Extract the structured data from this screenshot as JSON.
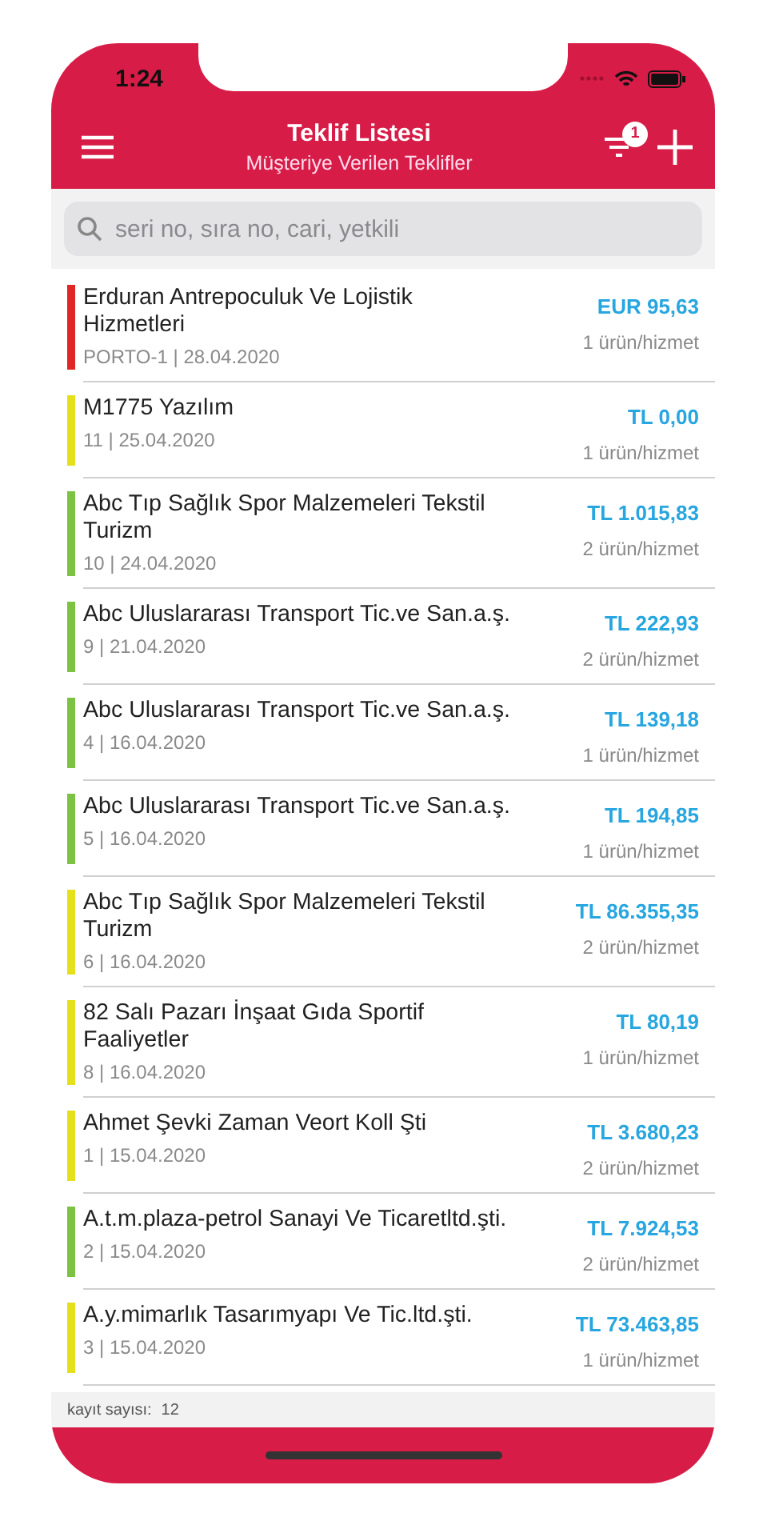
{
  "status_bar": {
    "time": "1:24"
  },
  "header": {
    "title": "Teklif Listesi",
    "subtitle": "Müşteriye Verilen Teklifler",
    "filter_badge": "1"
  },
  "search": {
    "placeholder": "seri no, sıra no, cari, yetkili"
  },
  "offers": [
    {
      "name": "Erduran Antrepoculuk Ve Lojistik Hizmetleri",
      "meta": "PORTO-1 | 28.04.2020",
      "amount": "EUR 95,63",
      "items": "1 ürün/hizmet",
      "color": "#e02626"
    },
    {
      "name": "M1775 Yazılım",
      "meta": "11 | 25.04.2020",
      "amount": "TL 0,00",
      "items": "1 ürün/hizmet",
      "color": "#e4e01c"
    },
    {
      "name": "Abc Tıp Sağlık Spor Malzemeleri Tekstil Turizm",
      "meta": "10 | 24.04.2020",
      "amount": "TL 1.015,83",
      "items": "2 ürün/hizmet",
      "color": "#7dc242"
    },
    {
      "name": "Abc Uluslararası Transport Tic.ve San.a.ş.",
      "meta": "9 | 21.04.2020",
      "amount": "TL 222,93",
      "items": "2 ürün/hizmet",
      "color": "#7dc242"
    },
    {
      "name": "Abc Uluslararası Transport Tic.ve San.a.ş.",
      "meta": "4 | 16.04.2020",
      "amount": "TL 139,18",
      "items": "1 ürün/hizmet",
      "color": "#7dc242"
    },
    {
      "name": "Abc Uluslararası Transport Tic.ve San.a.ş.",
      "meta": "5 | 16.04.2020",
      "amount": "TL 194,85",
      "items": "1 ürün/hizmet",
      "color": "#7dc242"
    },
    {
      "name": "Abc Tıp Sağlık Spor Malzemeleri Tekstil Turizm",
      "meta": "6 | 16.04.2020",
      "amount": "TL 86.355,35",
      "items": "2 ürün/hizmet",
      "color": "#e4e01c"
    },
    {
      "name": "82 Salı Pazarı İnşaat Gıda Sportif Faaliyetler",
      "meta": "8 | 16.04.2020",
      "amount": "TL 80,19",
      "items": "1 ürün/hizmet",
      "color": "#e4e01c"
    },
    {
      "name": "Ahmet Şevki Zaman Veort Koll Şti",
      "meta": "1 | 15.04.2020",
      "amount": "TL 3.680,23",
      "items": "2 ürün/hizmet",
      "color": "#e4e01c"
    },
    {
      "name": "A.t.m.plaza-petrol Sanayi Ve Ticaretltd.şti.",
      "meta": "2 | 15.04.2020",
      "amount": "TL 7.924,53",
      "items": "2 ürün/hizmet",
      "color": "#7dc242"
    },
    {
      "name": "A.y.mimarlık Tasarımyapı Ve Tic.ltd.şti.",
      "meta": "3 | 15.04.2020",
      "amount": "TL 73.463,85",
      "items": "1 ürün/hizmet",
      "color": "#e4e01c"
    }
  ],
  "footer": {
    "label": "kayıt sayısı:",
    "count": "12"
  }
}
